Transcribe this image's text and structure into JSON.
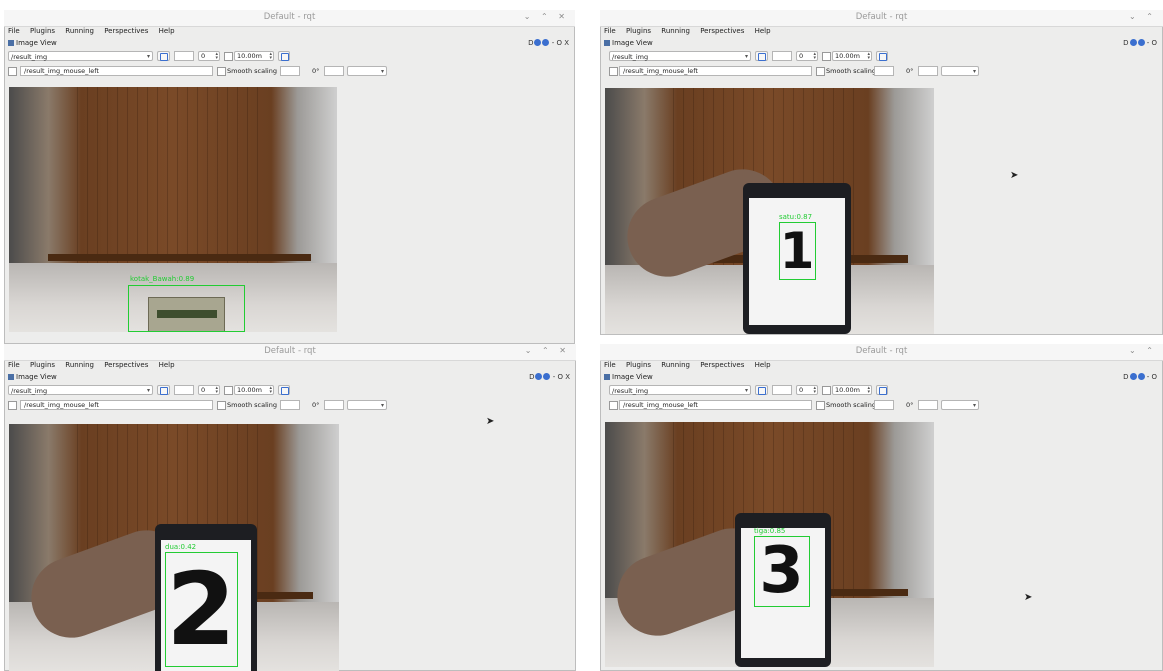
{
  "windows": [
    {
      "title": "Default - rqt",
      "window_controls": "⌄ ⌃ ✕",
      "menu": [
        "File",
        "Plugins",
        "Running",
        "Perspectives",
        "Help"
      ],
      "plugin_title": "Image View",
      "plugin_controls": "D",
      "plugin_controls_tail": "- O X",
      "topic": "/result_img",
      "spin_value": "0",
      "rate_value": "10.00m",
      "mouse_topic": "/result_img_mouse_left",
      "smooth_label": "Smooth scaling",
      "rotation": "0°",
      "detection_label": "kotak_Bawah:0.89",
      "digit": ""
    },
    {
      "title": "Default - rqt",
      "window_controls": "⌄ ⌃",
      "menu": [
        "File",
        "Plugins",
        "Running",
        "Perspectives",
        "Help"
      ],
      "plugin_title": "Image View",
      "plugin_controls": "D",
      "plugin_controls_tail": "- O",
      "topic": "/result_img",
      "spin_value": "0",
      "rate_value": "10.00m",
      "mouse_topic": "/result_img_mouse_left",
      "smooth_label": "Smooth scaling",
      "rotation": "0°",
      "detection_label": "satu:0.87",
      "digit": "1"
    },
    {
      "title": "Default - rqt",
      "window_controls": "⌄ ⌃ ✕",
      "menu": [
        "File",
        "Plugins",
        "Running",
        "Perspectives",
        "Help"
      ],
      "plugin_title": "Image View",
      "plugin_controls": "D",
      "plugin_controls_tail": "- O X",
      "topic": "/result_img",
      "spin_value": "0",
      "rate_value": "10.00m",
      "mouse_topic": "/result_img_mouse_left",
      "smooth_label": "Smooth scaling",
      "rotation": "0°",
      "detection_label": "dua:0.42",
      "digit": "2"
    },
    {
      "title": "Default - rqt",
      "window_controls": "⌄ ⌃",
      "menu": [
        "File",
        "Plugins",
        "Running",
        "Perspectives",
        "Help"
      ],
      "plugin_title": "Image View",
      "plugin_controls": "D",
      "plugin_controls_tail": "- O",
      "topic": "/result_img",
      "spin_value": "0",
      "rate_value": "10.00m",
      "mouse_topic": "/result_img_mouse_left",
      "smooth_label": "Smooth scaling",
      "rotation": "0°",
      "detection_label": "tiga:0.85",
      "digit": "3"
    }
  ],
  "colors": {
    "bbox": "#22cc33",
    "titlebar": "#f6f6f6",
    "window_bg": "#ededec"
  }
}
